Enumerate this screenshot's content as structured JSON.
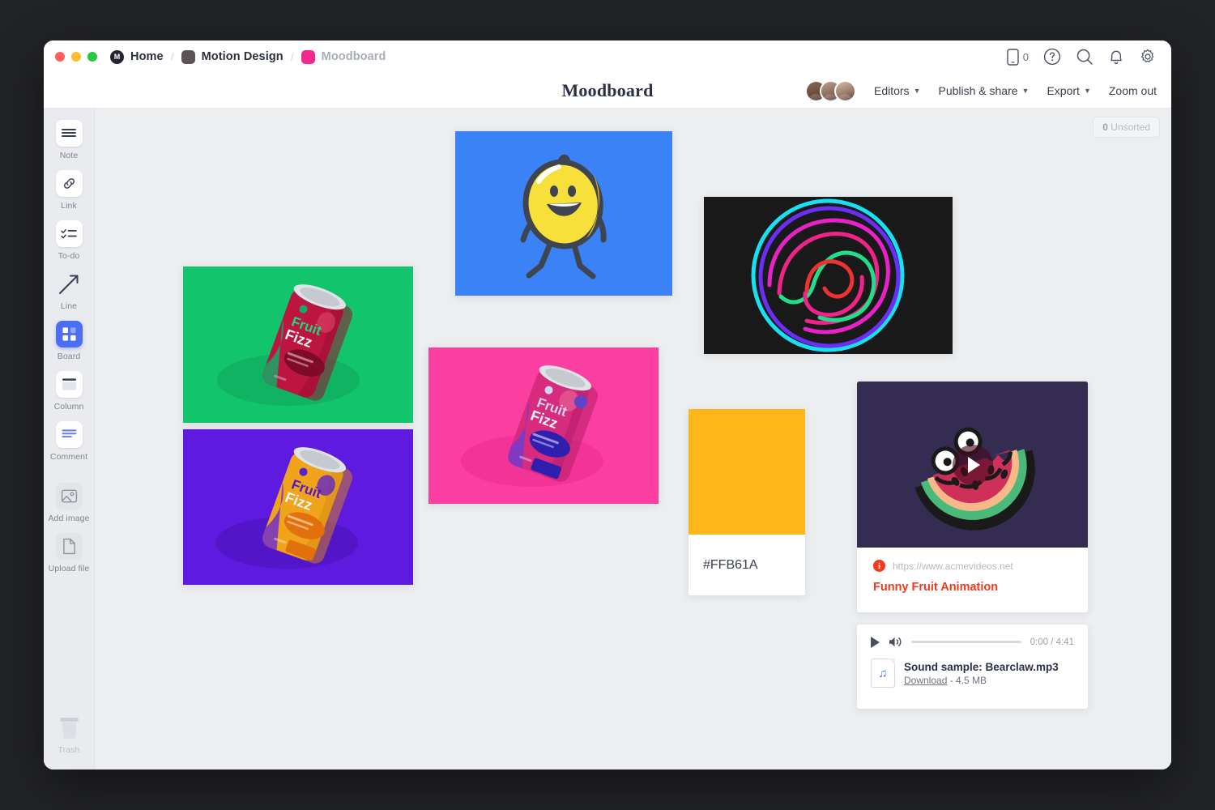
{
  "window": {
    "traffic_lights": [
      "close",
      "minimize",
      "maximize"
    ]
  },
  "breadcrumb": {
    "items": [
      {
        "label": "Home",
        "chip": "logo-chip",
        "muted": false
      },
      {
        "label": "Motion Design",
        "chip": "dark-chip",
        "muted": false
      },
      {
        "label": "Moodboard",
        "chip": "pink-chip",
        "muted": true
      }
    ],
    "separator": "/"
  },
  "titlebar_icons": [
    {
      "name": "mobile-preview-icon",
      "count": "0"
    },
    {
      "name": "help-icon"
    },
    {
      "name": "search-icon"
    },
    {
      "name": "notifications-bell-icon"
    },
    {
      "name": "settings-gear-icon"
    }
  ],
  "header": {
    "title": "Moodboard",
    "editors_label": "Editors",
    "publish_label": "Publish & share",
    "export_label": "Export",
    "zoom_label": "Zoom out",
    "avatar_count": 3
  },
  "sidebar": {
    "items": [
      {
        "label": "Note",
        "icon": "note-icon",
        "active": false
      },
      {
        "label": "Link",
        "icon": "link-icon",
        "active": false
      },
      {
        "label": "To-do",
        "icon": "todo-icon",
        "active": false
      },
      {
        "label": "Line",
        "icon": "line-arrow-icon",
        "active": false
      },
      {
        "label": "Board",
        "icon": "board-icon",
        "active": true
      },
      {
        "label": "Column",
        "icon": "column-icon",
        "active": false
      },
      {
        "label": "Comment",
        "icon": "comment-icon",
        "active": false
      },
      {
        "label": "Add image",
        "icon": "add-image-icon",
        "active": false
      },
      {
        "label": "Upload file",
        "icon": "upload-file-icon",
        "active": false
      }
    ],
    "trash_label": "Trash",
    "trash_icon": "trash-icon"
  },
  "canvas": {
    "unsorted_count": "0",
    "unsorted_label": "Unsorted",
    "cards": {
      "lemon": {
        "name": "lemon-character-image",
        "background": "#3b82f6"
      },
      "neon": {
        "name": "neon-spiral-image",
        "background": "#191919"
      },
      "can_green": {
        "name": "fruit-fizz-red-can-image",
        "background": "#12c46c",
        "brand_line1": "Fruit",
        "brand_line2": "Fizz"
      },
      "can_purple": {
        "name": "fruit-fizz-orange-can-image",
        "background": "#5f1ae0",
        "brand_line1": "Fruit",
        "brand_line2": "Fizz"
      },
      "can_pink": {
        "name": "fruit-fizz-pink-can-image",
        "background": "#fb3fa0",
        "brand_line1": "Fruit",
        "brand_line2": "Fizz"
      }
    },
    "swatch": {
      "hex": "#FFB61A",
      "label": "#FFB61A"
    },
    "video": {
      "url": "https://www.acmevideos.net",
      "title": "Funny Fruit Animation",
      "thumb_background": "#342c51",
      "play_button": "play-button"
    },
    "audio": {
      "time": "0:00 / 4:41",
      "file_name": "Sound sample: Bearclaw.mp3",
      "download_label": "Download",
      "size_label": "- 4.5 MB"
    }
  },
  "colors": {
    "accent": "#4c6ef5",
    "link_red": "#f2391d",
    "swatch": "#FFB61A"
  }
}
